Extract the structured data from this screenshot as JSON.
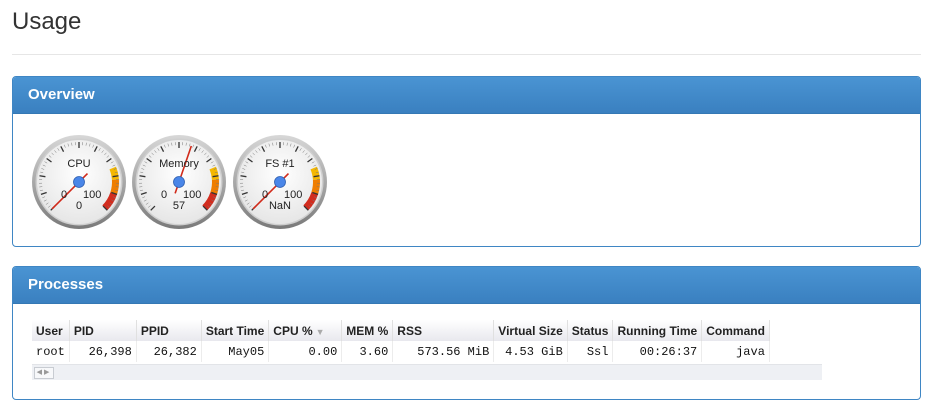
{
  "page": {
    "title": "Usage"
  },
  "overview": {
    "title": "Overview",
    "gauges": [
      {
        "title": "CPU",
        "min": "0",
        "max": "100",
        "value_label": "0",
        "value": 0
      },
      {
        "title": "Memory",
        "min": "0",
        "max": "100",
        "value_label": "57",
        "value": 57
      },
      {
        "title": "FS #1",
        "min": "0",
        "max": "100",
        "value_label": "NaN",
        "value": 0
      }
    ]
  },
  "processes": {
    "title": "Processes",
    "columns": [
      "User",
      "PID",
      "PPID",
      "Start Time",
      "CPU %",
      "MEM %",
      "RSS",
      "Virtual Size",
      "Status",
      "Running Time",
      "Command"
    ],
    "sorted_column": "CPU %",
    "rows": [
      [
        "root",
        "26,398",
        "26,382",
        "May05",
        "0.00",
        "3.60",
        "573.56 MiB",
        "4.53 GiB",
        "Ssl",
        "00:26:37",
        "java"
      ]
    ]
  },
  "colors": {
    "panel_header": "#3a80c0",
    "gauge_yellow": "#f5b800",
    "gauge_orange": "#ef7d00",
    "gauge_red": "#d22c1e",
    "needle": "#d12a1a",
    "hub": "#4a86e8"
  }
}
